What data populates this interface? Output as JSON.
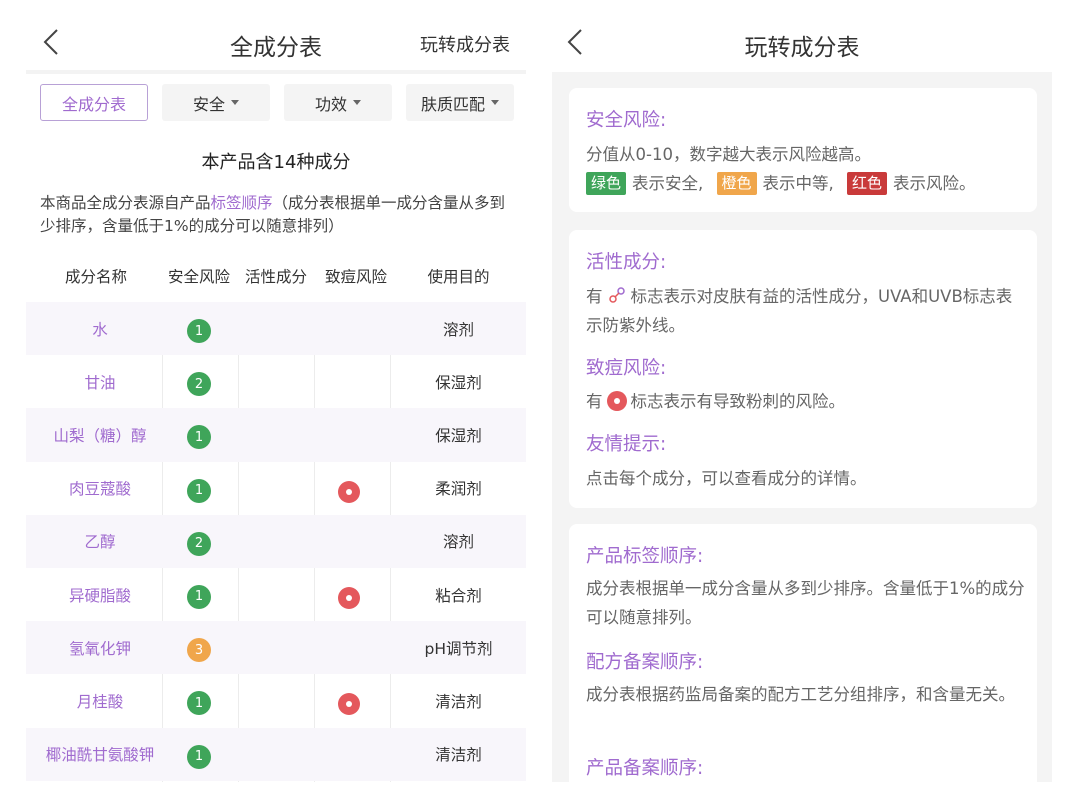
{
  "left": {
    "title": "全成分表",
    "link": "玩转成分表",
    "filters": [
      {
        "label": "全成分表",
        "active": true
      },
      {
        "label": "安全",
        "dropdown": true
      },
      {
        "label": "功效",
        "dropdown": true
      },
      {
        "label": "肤质匹配",
        "dropdown": true
      }
    ],
    "count_text": "本产品含14种成分",
    "desc_prefix": "本商品全成分表源自产品",
    "desc_link": "标签顺序",
    "desc_suffix": "（成分表根据单一成分含量从多到少排序，含量低于1%的成分可以随意排列）",
    "columns": [
      "成分名称",
      "安全风险",
      "活性成分",
      "致痘风险",
      "使用目的"
    ],
    "rows": [
      {
        "name": "水",
        "score": "1",
        "acne": false,
        "purpose": "溶剂"
      },
      {
        "name": "甘油",
        "score": "2",
        "acne": false,
        "purpose": "保湿剂"
      },
      {
        "name": "山梨（糖）醇",
        "score": "1",
        "acne": false,
        "purpose": "保湿剂"
      },
      {
        "name": "肉豆蔻酸",
        "score": "1",
        "acne": true,
        "purpose": "柔润剂"
      },
      {
        "name": "乙醇",
        "score": "2",
        "acne": false,
        "purpose": "溶剂"
      },
      {
        "name": "异硬脂酸",
        "score": "1",
        "acne": true,
        "purpose": "粘合剂"
      },
      {
        "name": "氢氧化钾",
        "score": "3",
        "acne": false,
        "purpose": "pH调节剂"
      },
      {
        "name": "月桂酸",
        "score": "1",
        "acne": true,
        "purpose": "清洁剂"
      },
      {
        "name": "椰油酰甘氨酸钾",
        "score": "1",
        "acne": false,
        "purpose": "清洁剂"
      }
    ],
    "score_colors": {
      "1": "#3fa55a",
      "2": "#3fa55a",
      "3": "#f0a64b"
    }
  },
  "right": {
    "title": "玩转成分表",
    "safety": {
      "heading": "安全风险:",
      "text1": "分值从0-10，数字越大表示风险越高。",
      "tag_green": "绿色",
      "text_green": "表示安全,",
      "tag_orange": "橙色",
      "text_orange": "表示中等,",
      "tag_red": "红色",
      "text_red": "表示风险。"
    },
    "active": {
      "heading": "活性成分:",
      "pre": "有",
      "post": "标志表示对皮肤有益的活性成分，UVA和UVB标志表示防紫外线。"
    },
    "acne": {
      "heading": "致痘风险:",
      "pre": "有",
      "post": "标志表示有导致粉刺的风险。"
    },
    "tip": {
      "heading": "友情提示:",
      "text": "点击每个成分，可以查看成分的详情。"
    },
    "label_order": {
      "heading": "产品标签顺序:",
      "text": "成分表根据单一成分含量从多到少排序。含量低于1%的成分可以随意排列。"
    },
    "formula_order": {
      "heading": "配方备案顺序:",
      "text": "成分表根据药监局备案的配方工艺分组排序，和含量无关。"
    },
    "product_order": {
      "heading": "产品备案顺序:"
    },
    "tag_colors": {
      "green": "#3fa55a",
      "orange": "#f0a64b",
      "red": "#c93a3a"
    }
  }
}
